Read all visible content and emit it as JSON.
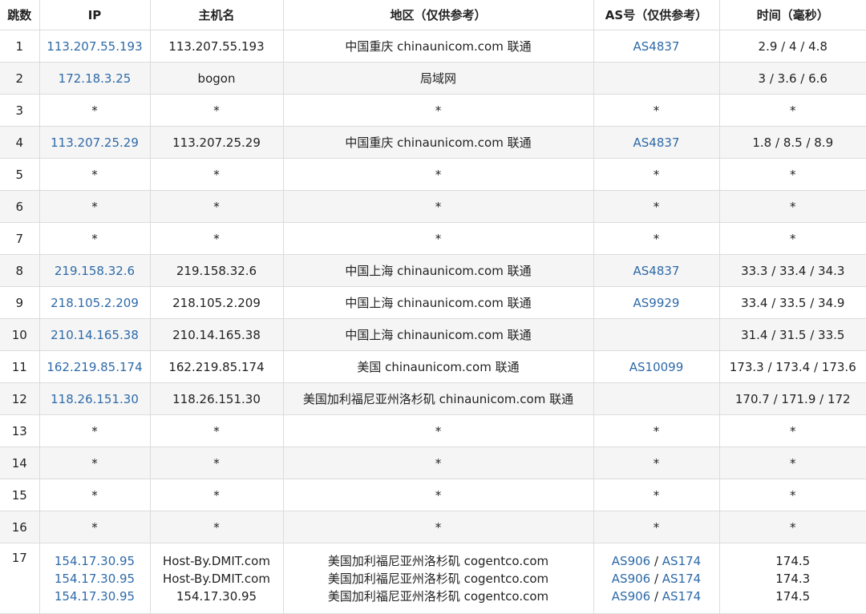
{
  "headers": {
    "hop": "跳数",
    "ip": "IP",
    "hostname": "主机名",
    "region": "地区（仅供参考）",
    "asn": "AS号（仅供参考）",
    "time": "时间（毫秒）"
  },
  "colors": {
    "link": "#2e6aa8",
    "stripe": "#f5f5f5",
    "border": "#dcdcdc"
  },
  "rows": [
    {
      "hop": "1",
      "ip": "113.207.55.193",
      "host": "113.207.55.193",
      "region": "中国重庆 chinaunicom.com 联通",
      "as": "AS4837",
      "time": "2.9 / 4 / 4.8"
    },
    {
      "hop": "2",
      "ip": "172.18.3.25",
      "host": "bogon",
      "region": "局域网",
      "as": "",
      "time": "3 / 3.6 / 6.6"
    },
    {
      "hop": "3",
      "ip": "*",
      "host": "*",
      "region": "*",
      "as": "*",
      "time": "*"
    },
    {
      "hop": "4",
      "ip": "113.207.25.29",
      "host": "113.207.25.29",
      "region": "中国重庆 chinaunicom.com 联通",
      "as": "AS4837",
      "time": "1.8 / 8.5 / 8.9"
    },
    {
      "hop": "5",
      "ip": "*",
      "host": "*",
      "region": "*",
      "as": "*",
      "time": "*"
    },
    {
      "hop": "6",
      "ip": "*",
      "host": "*",
      "region": "*",
      "as": "*",
      "time": "*"
    },
    {
      "hop": "7",
      "ip": "*",
      "host": "*",
      "region": "*",
      "as": "*",
      "time": "*"
    },
    {
      "hop": "8",
      "ip": "219.158.32.6",
      "host": "219.158.32.6",
      "region": "中国上海 chinaunicom.com 联通",
      "as": "AS4837",
      "time": "33.3 / 33.4 / 34.3"
    },
    {
      "hop": "9",
      "ip": "218.105.2.209",
      "host": "218.105.2.209",
      "region": "中国上海 chinaunicom.com 联通",
      "as": "AS9929",
      "time": "33.4 / 33.5 / 34.9"
    },
    {
      "hop": "10",
      "ip": "210.14.165.38",
      "host": "210.14.165.38",
      "region": "中国上海 chinaunicom.com 联通",
      "as": "",
      "time": "31.4 / 31.5 / 33.5"
    },
    {
      "hop": "11",
      "ip": "162.219.85.174",
      "host": "162.219.85.174",
      "region": "美国 chinaunicom.com 联通",
      "as": "AS10099",
      "time": "173.3 / 173.4 / 173.6"
    },
    {
      "hop": "12",
      "ip": "118.26.151.30",
      "host": "118.26.151.30",
      "region": "美国加利福尼亚州洛杉矶 chinaunicom.com 联通",
      "as": "",
      "time": "170.7 / 171.9 / 172"
    },
    {
      "hop": "13",
      "ip": "*",
      "host": "*",
      "region": "*",
      "as": "*",
      "time": "*"
    },
    {
      "hop": "14",
      "ip": "*",
      "host": "*",
      "region": "*",
      "as": "*",
      "time": "*"
    },
    {
      "hop": "15",
      "ip": "*",
      "host": "*",
      "region": "*",
      "as": "*",
      "time": "*"
    },
    {
      "hop": "16",
      "ip": "*",
      "host": "*",
      "region": "*",
      "as": "*",
      "time": "*"
    }
  ],
  "multi_row": {
    "hop": "17",
    "entries": [
      {
        "ip": "154.17.30.95",
        "host": "Host-By.DMIT.com",
        "region": "美国加利福尼亚州洛杉矶 cogentco.com",
        "as1": "AS906",
        "as2": "AS174",
        "time": "174.5"
      },
      {
        "ip": "154.17.30.95",
        "host": "Host-By.DMIT.com",
        "region": "美国加利福尼亚州洛杉矶 cogentco.com",
        "as1": "AS906",
        "as2": "AS174",
        "time": "174.3"
      },
      {
        "ip": "154.17.30.95",
        "host": "154.17.30.95",
        "region": "美国加利福尼亚州洛杉矶 cogentco.com",
        "as1": "AS906",
        "as2": "AS174",
        "time": "174.5"
      }
    ],
    "as_separator": " / "
  }
}
